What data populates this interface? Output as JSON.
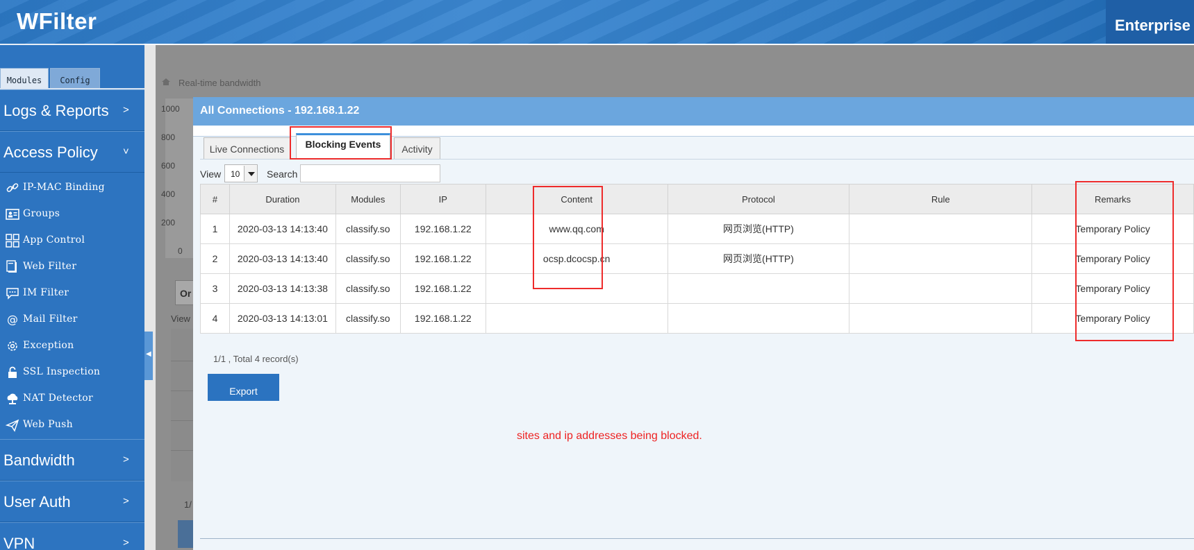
{
  "app": {
    "brand": "WFilter",
    "edition": "Enterprise"
  },
  "sidebar": {
    "tabs": [
      "Modules",
      "Config"
    ],
    "sections": [
      {
        "label": "Logs & Reports",
        "arrow": ">"
      },
      {
        "label": "Access Policy",
        "arrow": "˅"
      },
      {
        "label": "Bandwidth",
        "arrow": ">"
      },
      {
        "label": "User Auth",
        "arrow": ">"
      },
      {
        "label": "VPN",
        "arrow": ">"
      }
    ],
    "items": [
      {
        "label": "IP-MAC Binding",
        "icon": "link-icon"
      },
      {
        "label": "Groups",
        "icon": "id-card-icon"
      },
      {
        "label": "App Control",
        "icon": "app-grid-icon"
      },
      {
        "label": "Web Filter",
        "icon": "web-page-icon"
      },
      {
        "label": "IM Filter",
        "icon": "chat-bubble-icon"
      },
      {
        "label": "Mail Filter",
        "icon": "at-sign-icon"
      },
      {
        "label": "Exception",
        "icon": "gear-icon"
      },
      {
        "label": "SSL Inspection",
        "icon": "lock-icon"
      },
      {
        "label": "NAT Detector",
        "icon": "cloud-network-icon"
      },
      {
        "label": "Web Push",
        "icon": "paper-plane-icon"
      }
    ]
  },
  "background": {
    "breadcrumb": "Real-time bandwidth",
    "y_ticks": [
      "1000",
      "800",
      "600",
      "400",
      "200",
      "0"
    ],
    "tab_fragment": "Or",
    "view_fragment": "View",
    "page_fragment": "1/"
  },
  "modal": {
    "title": "All Connections - 192.168.1.22",
    "tabs": [
      "Live Connections",
      "Blocking Events",
      "Activity"
    ],
    "active_tab": "Blocking Events",
    "view_label": "View",
    "view_value": "10",
    "search_label": "Search",
    "search_value": "",
    "table": {
      "columns": [
        "#",
        "Duration",
        "Modules",
        "IP",
        "Content",
        "Protocol",
        "Rule",
        "Remarks"
      ],
      "rows": [
        [
          "1",
          "2020-03-13 14:13:40",
          "classify.so",
          "192.168.1.22",
          "www.qq.com",
          "网页浏览(HTTP)",
          "",
          "Temporary Policy"
        ],
        [
          "2",
          "2020-03-13 14:13:40",
          "classify.so",
          "192.168.1.22",
          "ocsp.dcocsp.cn",
          "网页浏览(HTTP)",
          "",
          "Temporary Policy"
        ],
        [
          "3",
          "2020-03-13 14:13:38",
          "classify.so",
          "192.168.1.22",
          "",
          "",
          "",
          "Temporary Policy"
        ],
        [
          "4",
          "2020-03-13 14:13:01",
          "classify.so",
          "192.168.1.22",
          "",
          "",
          "",
          "Temporary Policy"
        ]
      ]
    },
    "pager": "1/1 , Total 4 record(s)",
    "export_label": "Export",
    "annotation": "sites and ip addresses being blocked."
  },
  "colors": {
    "header_blue": "#2c78c4",
    "sidebar_blue": "#2d74c0",
    "modal_title_blue": "#6ba6de",
    "active_tab_accent": "#3d8fdb",
    "export_button": "#2b73c0",
    "annotation_red": "#ee2222"
  }
}
